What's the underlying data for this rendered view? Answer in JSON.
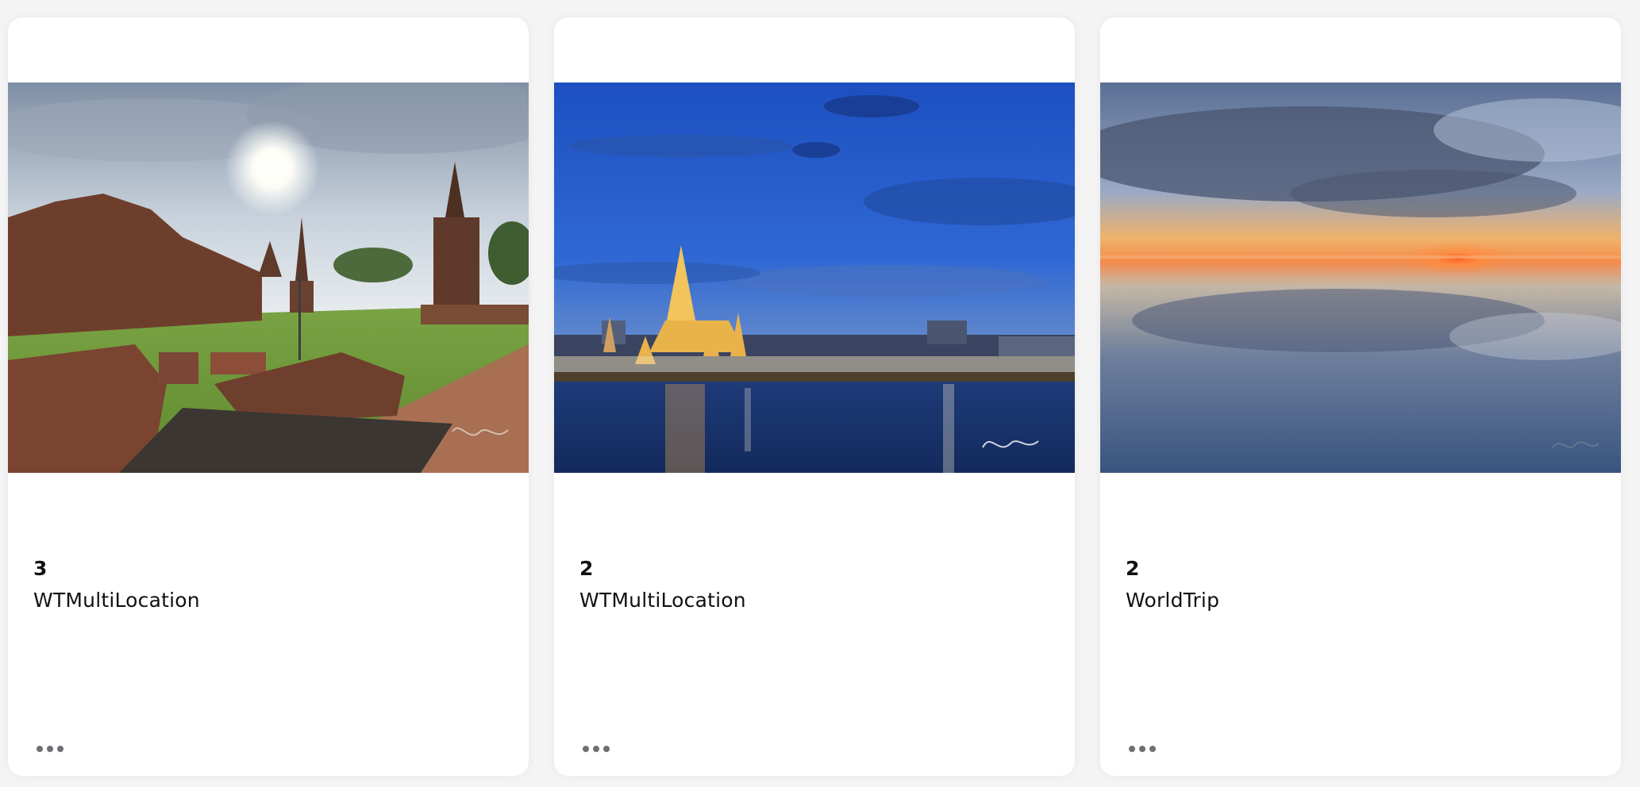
{
  "cards": [
    {
      "count": "3",
      "name": "WTMultiLocation",
      "image": "ancient temple ruins photo"
    },
    {
      "count": "2",
      "name": "WTMultiLocation",
      "image": "illuminated riverside temple at dusk photo"
    },
    {
      "count": "2",
      "name": "WorldTrip",
      "image": "sunset reflected on calm water photo"
    }
  ],
  "icons": {
    "more": "more-horizontal-icon"
  }
}
